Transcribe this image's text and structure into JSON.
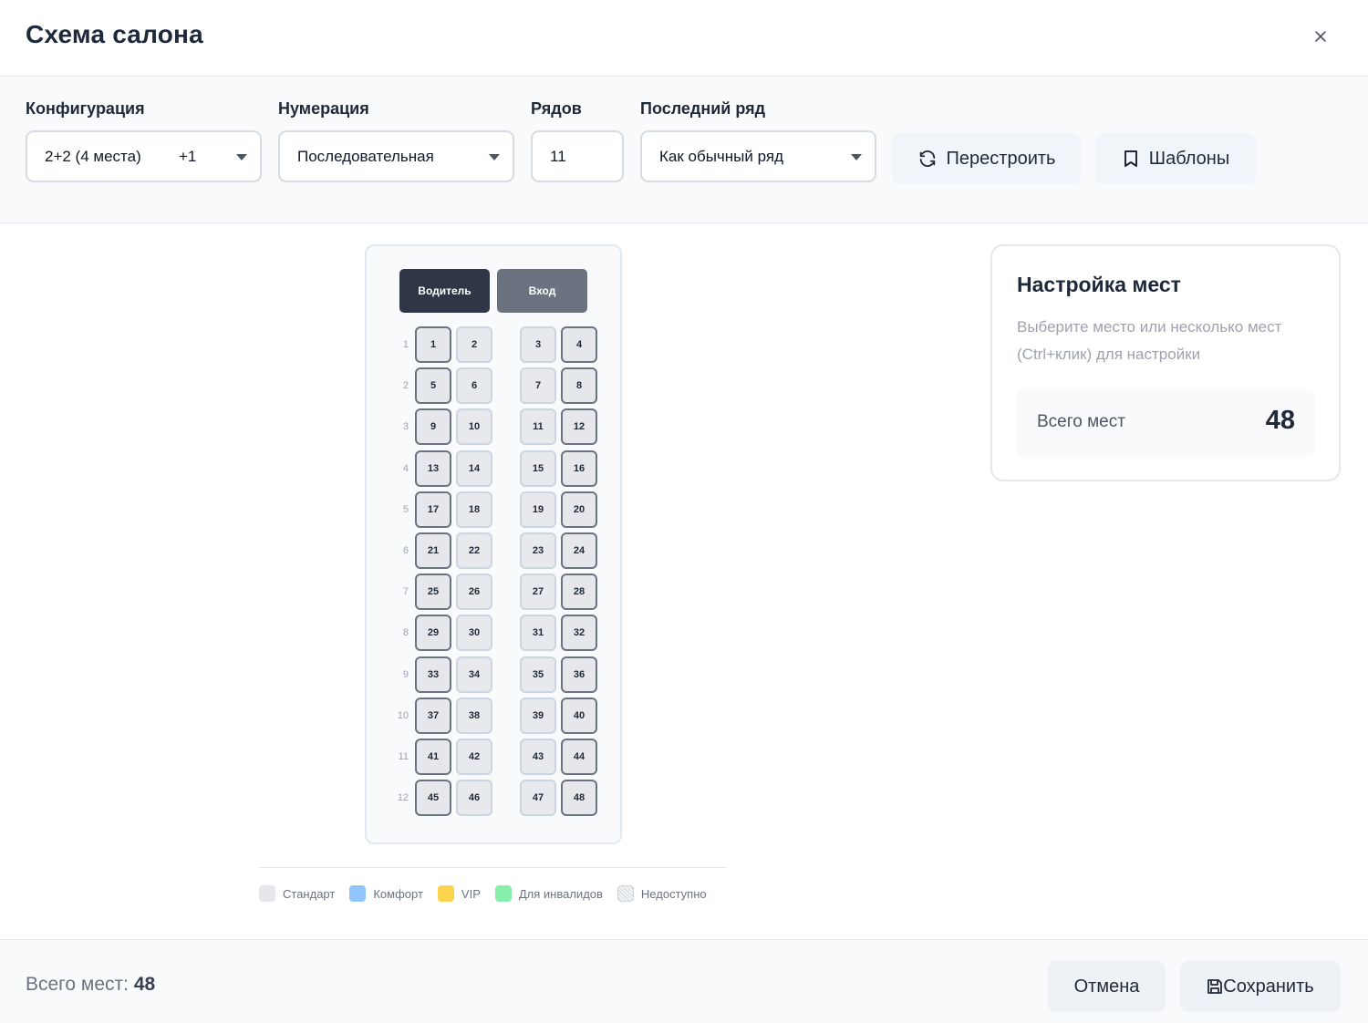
{
  "dialog": {
    "title": "Схема салона"
  },
  "controls": {
    "configuration": {
      "label": "Конфигурация",
      "value": "2+2 (4 места)",
      "extra": "+1"
    },
    "numbering": {
      "label": "Нумерация",
      "value": "Последовательная"
    },
    "rows": {
      "label": "Рядов",
      "value": "11"
    },
    "last_row": {
      "label": "Последний ряд",
      "value": "Как обычный ряд"
    },
    "rebuild_button": {
      "label": "Перестроить",
      "icon": "refresh-icon"
    },
    "templates_button": {
      "label": "Шаблоны",
      "icon": "bookmark-icon"
    }
  },
  "seat_map": {
    "driver_label": "Водитель",
    "entrance_label": "Вход",
    "rows": [
      {
        "num": "1",
        "seats": [
          "1",
          "2",
          "3",
          "4"
        ]
      },
      {
        "num": "2",
        "seats": [
          "5",
          "6",
          "7",
          "8"
        ]
      },
      {
        "num": "3",
        "seats": [
          "9",
          "10",
          "11",
          "12"
        ]
      },
      {
        "num": "4",
        "seats": [
          "13",
          "14",
          "15",
          "16"
        ]
      },
      {
        "num": "5",
        "seats": [
          "17",
          "18",
          "19",
          "20"
        ]
      },
      {
        "num": "6",
        "seats": [
          "21",
          "22",
          "23",
          "24"
        ]
      },
      {
        "num": "7",
        "seats": [
          "25",
          "26",
          "27",
          "28"
        ]
      },
      {
        "num": "8",
        "seats": [
          "29",
          "30",
          "31",
          "32"
        ]
      },
      {
        "num": "9",
        "seats": [
          "33",
          "34",
          "35",
          "36"
        ]
      },
      {
        "num": "10",
        "seats": [
          "37",
          "38",
          "39",
          "40"
        ]
      },
      {
        "num": "11",
        "seats": [
          "41",
          "42",
          "43",
          "44"
        ]
      },
      {
        "num": "12",
        "seats": [
          "45",
          "46",
          "47",
          "48"
        ]
      }
    ]
  },
  "legend": [
    {
      "label": "Стандарт",
      "color": "#e5e7eb"
    },
    {
      "label": "Комфорт",
      "color": "#93c5fd"
    },
    {
      "label": "VIP",
      "color": "#fcd34d"
    },
    {
      "label": "Для инвалидов",
      "color": "#86efac"
    },
    {
      "label": "Недоступно",
      "color": "hatched"
    }
  ],
  "settings_panel": {
    "title": "Настройка мест",
    "hint": "Выберите место или несколько мест (Ctrl+клик) для настройки",
    "total_label": "Всего мест",
    "total_value": "48"
  },
  "footer": {
    "total_label": "Всего мест:",
    "total_value": "48",
    "cancel_label": "Отмена",
    "save_label": "Сохранить"
  },
  "colors": {
    "driver_tag": "#2f3747",
    "entrance_tag": "#6b7280",
    "seat_fill": "#e5e7eb",
    "seat_border": "#9ca3af"
  }
}
